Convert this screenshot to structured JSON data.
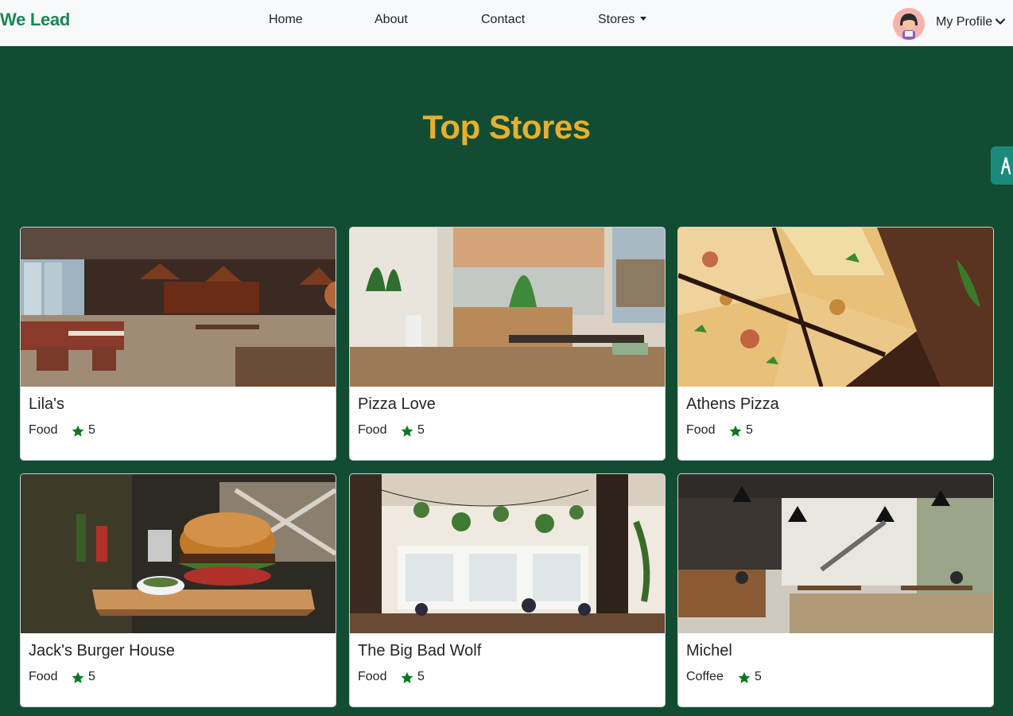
{
  "nav": {
    "brand": "We Lead",
    "links": [
      "Home",
      "About",
      "Contact",
      "Stores"
    ],
    "profile_label": "My Profile"
  },
  "page": {
    "title": "Top Stores"
  },
  "stores": [
    {
      "name": "Lila's",
      "category": "Food",
      "rating": "5"
    },
    {
      "name": "Pizza Love",
      "category": "Food",
      "rating": "5"
    },
    {
      "name": "Athens Pizza",
      "category": "Food",
      "rating": "5"
    },
    {
      "name": "Jack's Burger House",
      "category": "Food",
      "rating": "5"
    },
    {
      "name": "The Big Bad Wolf",
      "category": "Food",
      "rating": "5"
    },
    {
      "name": "Michel",
      "category": "Coffee",
      "rating": "5"
    }
  ],
  "colors": {
    "brand": "#198754",
    "background": "#124d33",
    "title": "#e6b02e",
    "star": "#0a7a1e"
  },
  "icons": {
    "star": "star-icon",
    "dropdown": "caret-down-icon",
    "profile_chevron": "chevron-down-icon"
  }
}
